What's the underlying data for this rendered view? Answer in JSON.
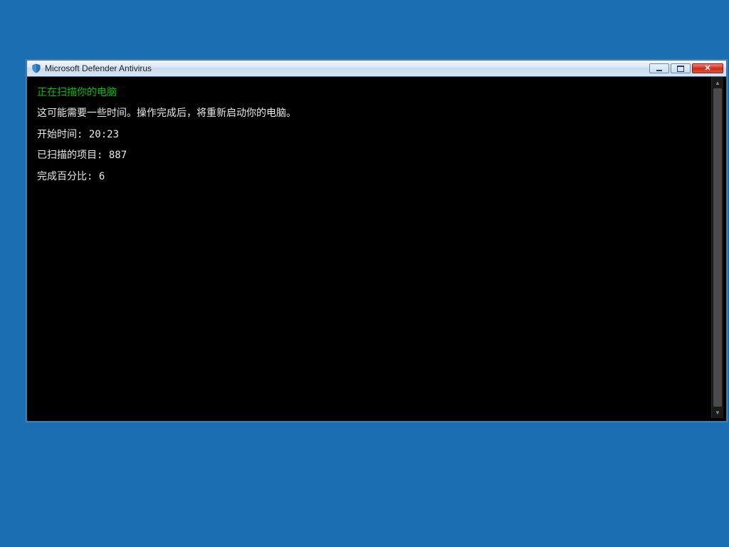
{
  "window": {
    "title": "Microsoft Defender Antivirus"
  },
  "console": {
    "heading": "正在扫描你的电脑",
    "message": "这可能需要一些时间。操作完成后，将重新启动你的电脑。",
    "start_time_label": "开始时间:",
    "start_time_value": "20:23",
    "scanned_label": "已扫描的项目:",
    "scanned_value": "887",
    "percent_label": "完成百分比:",
    "percent_value": "6"
  }
}
